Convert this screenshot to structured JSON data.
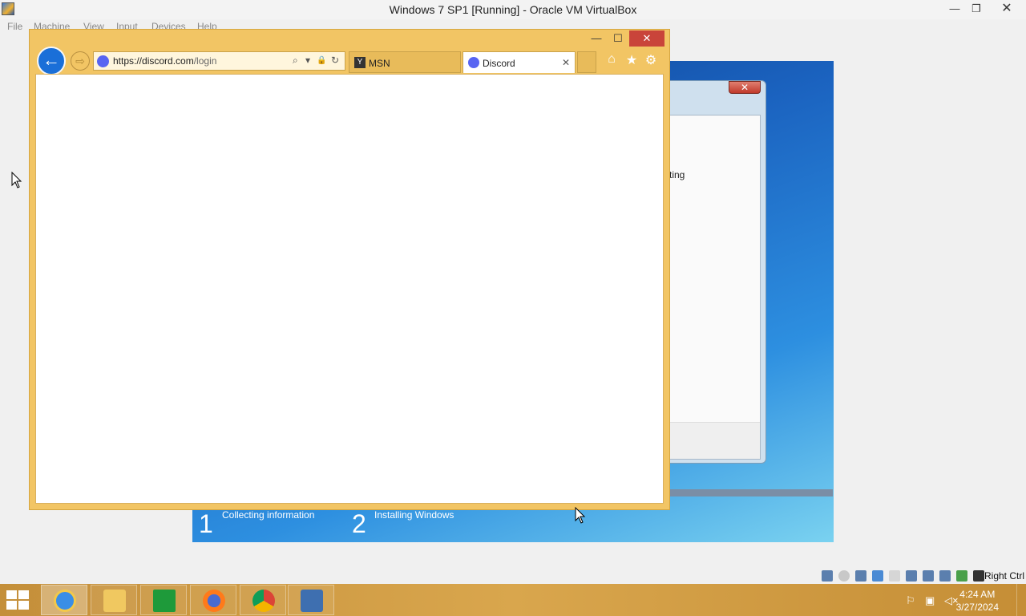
{
  "host": {
    "title": "Windows 7 SP1 [Running] - Oracle VM VirtualBox",
    "window_controls": {
      "minimize": "—",
      "restore": "❐",
      "close": "✕"
    },
    "menu": [
      "File",
      "Machine",
      "View",
      "Input",
      "Devices",
      "Help"
    ],
    "status_host_key": "Right Ctrl"
  },
  "guest": {
    "dialog_fragment": "ting",
    "dialog_close": "✕",
    "steps": [
      {
        "num": "1",
        "label": "Collecting information"
      },
      {
        "num": "2",
        "label": "Installing Windows"
      }
    ]
  },
  "ie": {
    "controls": {
      "minimize": "—",
      "maximize": "☐",
      "close": "✕"
    },
    "back_glyph": "←",
    "forward_glyph": "⇨",
    "address": {
      "domain": "https://discord.com",
      "path": "/login"
    },
    "address_icons": {
      "search": "⌕",
      "dropdown": "▾",
      "lock": "🔒",
      "refresh": "↻"
    },
    "tabs": [
      {
        "label": "MSN",
        "icon": "Y",
        "active": false
      },
      {
        "label": "Discord",
        "active": true,
        "close": "✕"
      }
    ],
    "toolbar_icons": {
      "home": "⌂",
      "favorites": "★",
      "settings": "⚙"
    }
  },
  "taskbar": {
    "clock_time": "4:24 AM",
    "clock_date": "3/27/2024",
    "tray": {
      "flag": "⚐",
      "network": "▣",
      "volume": "◁×"
    }
  },
  "colors": {
    "ie_frame": "#f2c564",
    "taskbar": "#d9a64d",
    "ie_back": "#1a6fd8",
    "discord": "#5865f2"
  }
}
